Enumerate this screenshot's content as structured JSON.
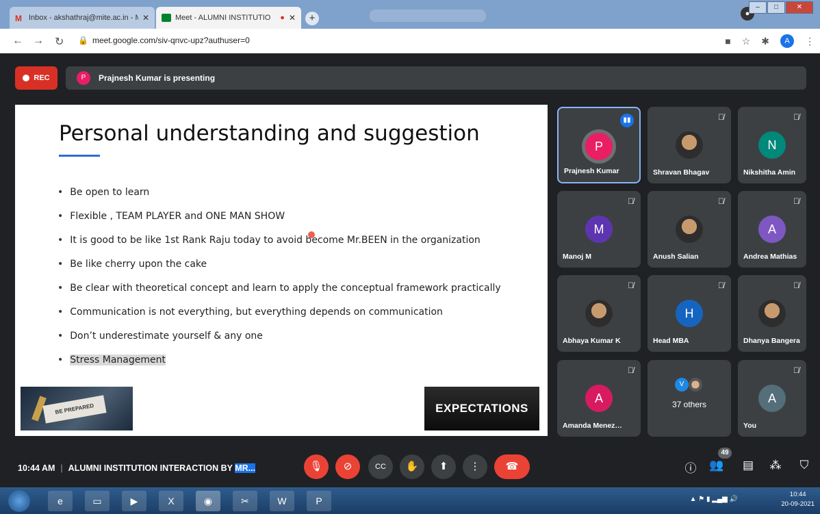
{
  "browser": {
    "tabs": [
      {
        "title": "Inbox - akshathraj@mite.ac.in - M"
      },
      {
        "title": "Meet - ALUMNI INSTITUTIO"
      }
    ],
    "url": "meet.google.com/siv-qnvc-upz?authuser=0",
    "profile_initial": "A"
  },
  "meet": {
    "rec_label": "REC",
    "presenter_initial": "P",
    "presenting_text": "Prajnesh Kumar is presenting",
    "slide": {
      "title": "Personal understanding and suggestion",
      "bullets": [
        "Be open to learn",
        "Flexible , TEAM PLAYER and ONE MAN SHOW",
        "It is good to be like 1st Rank Raju today to avoid become Mr.BEEN in the organization",
        "Be like cherry upon the cake",
        "Be clear with theoretical concept and learn to apply the conceptual framework practically",
        "Communication is not everything, but everything depends on communication",
        "Don’t underestimate yourself & any one",
        "Stress Management"
      ],
      "image_left_text": "BE PREPARED",
      "image_right_text": "EXPECTATIONS"
    },
    "participants": [
      {
        "name": "Prajnesh Kumar",
        "initial": "P",
        "color": "#e91e63"
      },
      {
        "name": "Shravan Bhagav",
        "initial": "",
        "color": "#5d4037"
      },
      {
        "name": "Nikshitha Amin",
        "initial": "N",
        "color": "#00897b"
      },
      {
        "name": "Manoj M",
        "initial": "M",
        "color": "#5e35b1"
      },
      {
        "name": "Anush Salian",
        "initial": "",
        "color": "#455a64"
      },
      {
        "name": "Andrea Mathias",
        "initial": "A",
        "color": "#7e57c2"
      },
      {
        "name": "Abhaya Kumar K",
        "initial": "",
        "color": "#6d4c41"
      },
      {
        "name": "Head MBA",
        "initial": "H",
        "color": "#1565c0"
      },
      {
        "name": "Dhanya Bangera",
        "initial": "",
        "color": "#8d6e63"
      },
      {
        "name": "Amanda Menez…",
        "initial": "A",
        "color": "#d81b60"
      },
      {
        "name": "37 others",
        "initial": "V",
        "color": "#1e88e5"
      },
      {
        "name": "You",
        "initial": "A",
        "color": "#546e7a"
      }
    ],
    "time": "10:44 AM",
    "meeting_title": "ALUMNI INSTITUTION INTERACTION BY ",
    "meeting_title_selected": "MR...",
    "people_count": "49"
  },
  "taskbar": {
    "time": "10:44",
    "date": "20-09-2021"
  }
}
